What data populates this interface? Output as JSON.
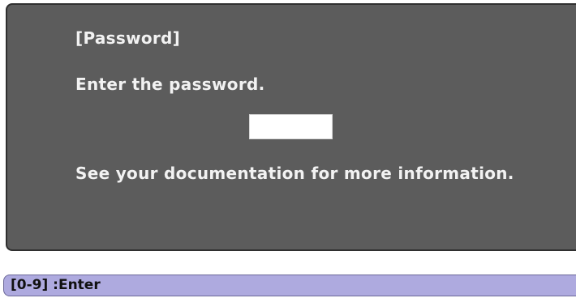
{
  "dialog": {
    "title": "[Password]",
    "prompt": "Enter the password.",
    "password_value": "",
    "info": "See your documentation for more information."
  },
  "status_bar": {
    "hint": "[0-9] :Enter"
  },
  "colors": {
    "dialog_background": "#5c5c5c",
    "dialog_text": "#f2f2f2",
    "status_background": "#aeaadf"
  }
}
